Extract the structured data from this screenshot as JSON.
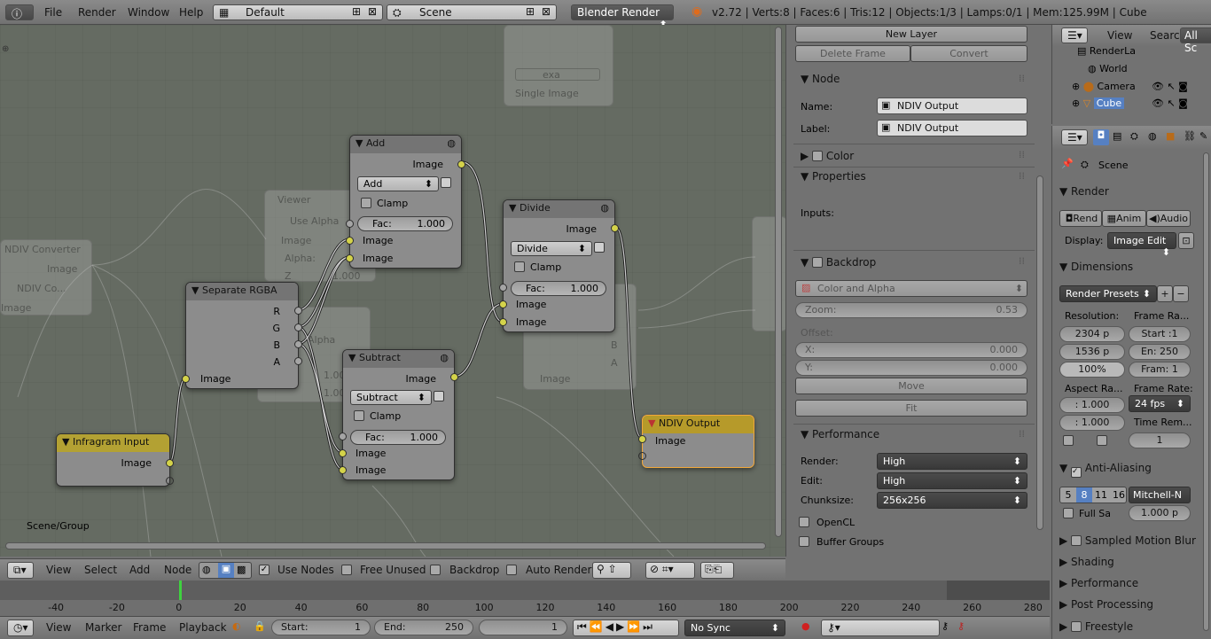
{
  "topbar": {
    "menus": [
      "File",
      "Render",
      "Window",
      "Help"
    ],
    "layout": "Default",
    "scene": "Scene",
    "engine": "Blender Render",
    "stats": "v2.72 | Verts:8 | Faces:6 | Tris:12 | Objects:1/3 | Lamps:0/1 | Mem:125.99M | Cube"
  },
  "nodes": {
    "infragram": {
      "title": "Infragram Input",
      "out": "Image"
    },
    "separate": {
      "title": "Separate RGBA",
      "outs": [
        "R",
        "G",
        "B",
        "A"
      ],
      "in": "Image"
    },
    "add": {
      "title": "Add",
      "out": "Image",
      "op": "Add",
      "clamp": "Clamp",
      "fac_label": "Fac:",
      "fac": "1.000",
      "in1": "Image",
      "in2": "Image"
    },
    "subtract": {
      "title": "Subtract",
      "out": "Image",
      "op": "Subtract",
      "clamp": "Clamp",
      "fac_label": "Fac:",
      "fac": "1.000",
      "in1": "Image",
      "in2": "Image"
    },
    "divide": {
      "title": "Divide",
      "out": "Image",
      "op": "Divide",
      "clamp": "Clamp",
      "fac_label": "Fac:",
      "fac": "1.000",
      "in1": "Image",
      "in2": "Image"
    },
    "output": {
      "title": "NDIV Output",
      "in": "Image"
    },
    "ghost_viewer": {
      "title": "Viewer",
      "use_alpha": "Use Alpha",
      "image": "Image",
      "alpha": "Alpha:",
      "z": "Z",
      "zval": "1.000"
    },
    "ghost_converter": {
      "title": "NDIV Converter",
      "image": "Image",
      "field": "NDIV Co...",
      "image2": "Image"
    },
    "ghost_top": {
      "field": "exa",
      "mode": "Single Image"
    },
    "ghost_mid": {
      "label": "Alpha",
      "v1": "1.000",
      "v2": "1.000"
    },
    "ghost_right": {
      "image": "Image",
      "b": "B",
      "a": "A"
    }
  },
  "editor": {
    "group_label": "Scene/Group"
  },
  "node_header": {
    "menus": [
      "View",
      "Select",
      "Add",
      "Node"
    ],
    "use_nodes": "Use Nodes",
    "free_unused": "Free Unused",
    "backdrop": "Backdrop",
    "auto_render": "Auto Render"
  },
  "props": {
    "new_layer": "New Layer",
    "delete_frame": "Delete Frame",
    "convert": "Convert",
    "node_panel": "Node",
    "name_label": "Name:",
    "name_value": "NDIV Output",
    "label_label": "Label:",
    "label_value": "NDIV Output",
    "color_panel": "Color",
    "properties_panel": "Properties",
    "inputs_label": "Inputs:",
    "backdrop_panel": "Backdrop",
    "backdrop_mode": "Color and Alpha",
    "zoom_label": "Zoom:",
    "zoom_value": "0.53",
    "offset_label": "Offset:",
    "x_label": "X:",
    "x_value": "0.000",
    "y_label": "Y:",
    "y_value": "0.000",
    "move": "Move",
    "fit": "Fit",
    "performance_panel": "Performance",
    "render_label": "Render:",
    "render_value": "High",
    "edit_label": "Edit:",
    "edit_value": "High",
    "chunk_label": "Chunksize:",
    "chunk_value": "256x256",
    "opencl": "OpenCL",
    "buffer_groups": "Buffer Groups"
  },
  "outliner": {
    "menus": [
      "View",
      "Search"
    ],
    "filter": "All Sc",
    "items": [
      "RenderLa",
      "World",
      "Camera",
      "Cube"
    ]
  },
  "render": {
    "scene": "Scene",
    "render_panel": "Render",
    "rend": "Rend",
    "anim": "Anim",
    "audio": "Audio",
    "display_label": "Display:",
    "display_value": "Image Edit",
    "dimensions_panel": "Dimensions",
    "presets": "Render Presets",
    "resolution_label": "Resolution:",
    "res_x": "2304 p",
    "res_y": "1536 p",
    "res_pct": "100%",
    "frame_range_label": "Frame Ra...",
    "start": "Start :1",
    "end": "En: 250",
    "frame": "Fram: 1",
    "aspect_label": "Aspect Ra...",
    "aspect_x": ": 1.000",
    "aspect_y": ": 1.000",
    "frame_rate_label": "Frame Rate:",
    "fps": "24 fps",
    "time_remap_label": "Time Rem...",
    "time_remap_value": "1",
    "aa_panel": "Anti-Aliasing",
    "aa_samples": [
      "5",
      "8",
      "11",
      "16"
    ],
    "aa_filter": "Mitchell-N",
    "full_sample": "Full Sa",
    "filter_size": "1.000 p",
    "sampled_motion_blur": "Sampled Motion Blur",
    "shading": "Shading",
    "performance": "Performance",
    "post_processing": "Post Processing",
    "freestyle": "Freestyle"
  },
  "timeline": {
    "ticks": [
      "-40",
      "-20",
      "0",
      "20",
      "40",
      "60",
      "80",
      "100",
      "120",
      "140",
      "160",
      "180",
      "200",
      "220",
      "240",
      "260",
      "280"
    ],
    "menus": [
      "View",
      "Marker",
      "Frame",
      "Playback"
    ],
    "start_label": "Start:",
    "start_value": "1",
    "end_label": "End:",
    "end_value": "250",
    "current": "1",
    "sync": "No Sync"
  },
  "colors": {
    "socket": "#d4d34a",
    "selected_border": "#f3a83a",
    "node_bg": "#8c8c8c",
    "editor_bg": "#656b62"
  }
}
